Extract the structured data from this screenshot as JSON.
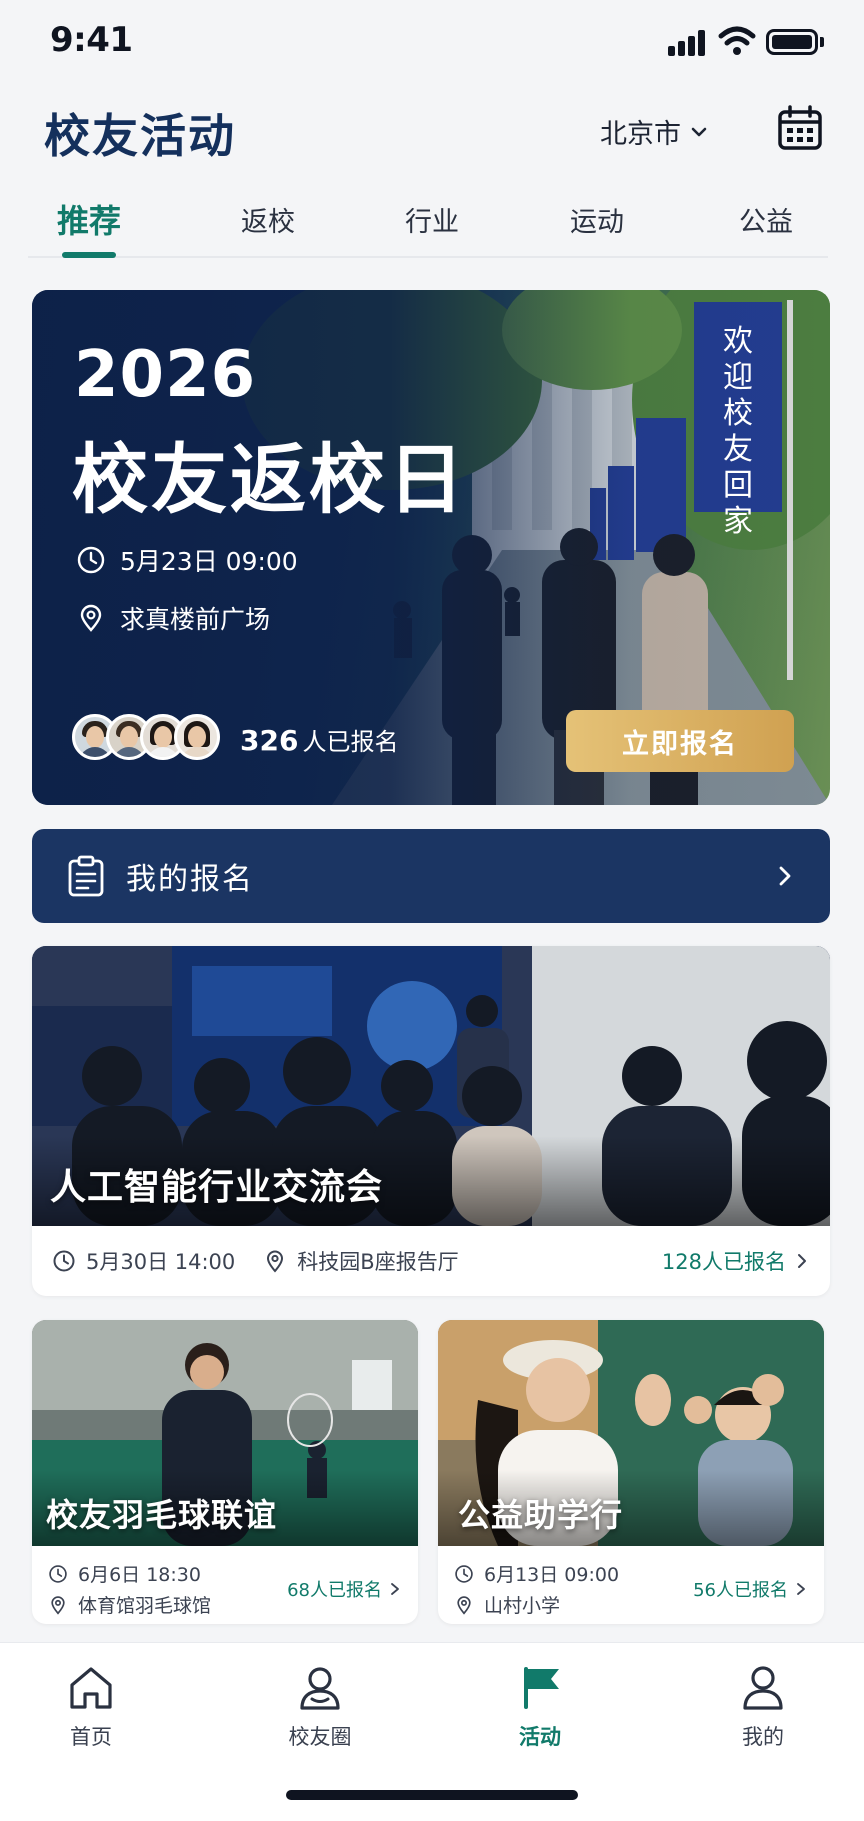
{
  "status_bar": {
    "time": "9:41"
  },
  "header": {
    "title": "校友活动",
    "city": "北京市",
    "icons": {
      "city_chevron": "chevron-down-icon",
      "calendar": "calendar-icon"
    }
  },
  "tabs": [
    {
      "label": "推荐",
      "active": true
    },
    {
      "label": "返校",
      "active": false
    },
    {
      "label": "行业",
      "active": false
    },
    {
      "label": "运动",
      "active": false
    },
    {
      "label": "公益",
      "active": false
    }
  ],
  "hero": {
    "year": "2026",
    "title": "校友返校日",
    "time": "5月23日 09:00",
    "location": "求真楼前广场",
    "signup_number": "326",
    "signup_suffix": "人已报名",
    "register_label": "立即报名",
    "banner_text": "欢迎校友回家",
    "icons": {
      "time": "clock-icon",
      "location": "location-pin-icon"
    }
  },
  "my_signup": {
    "label": "我的报名",
    "icon": "clipboard-icon"
  },
  "featured_event": {
    "title": "人工智能行业交流会",
    "time": "5月30日 14:00",
    "location": "科技园B座报告厅",
    "count": "128人已报名"
  },
  "events": [
    {
      "title": "校友羽毛球联谊",
      "time": "6月6日 18:30",
      "location": "体育馆羽毛球馆",
      "count": "68人已报名"
    },
    {
      "title": "公益助学行",
      "time": "6月13日 09:00",
      "location": "山村小学",
      "count": "56人已报名"
    }
  ],
  "bottom_nav": [
    {
      "label": "首页",
      "icon": "home-icon",
      "active": false
    },
    {
      "label": "校友圈",
      "icon": "people-icon",
      "active": false
    },
    {
      "label": "活动",
      "icon": "flag-icon",
      "active": true
    },
    {
      "label": "我的",
      "icon": "person-icon",
      "active": false
    }
  ],
  "colors": {
    "brand": "#14305C",
    "accent": "#117A6A",
    "gold": "#D9AE5F",
    "banner": "#1B3563"
  }
}
